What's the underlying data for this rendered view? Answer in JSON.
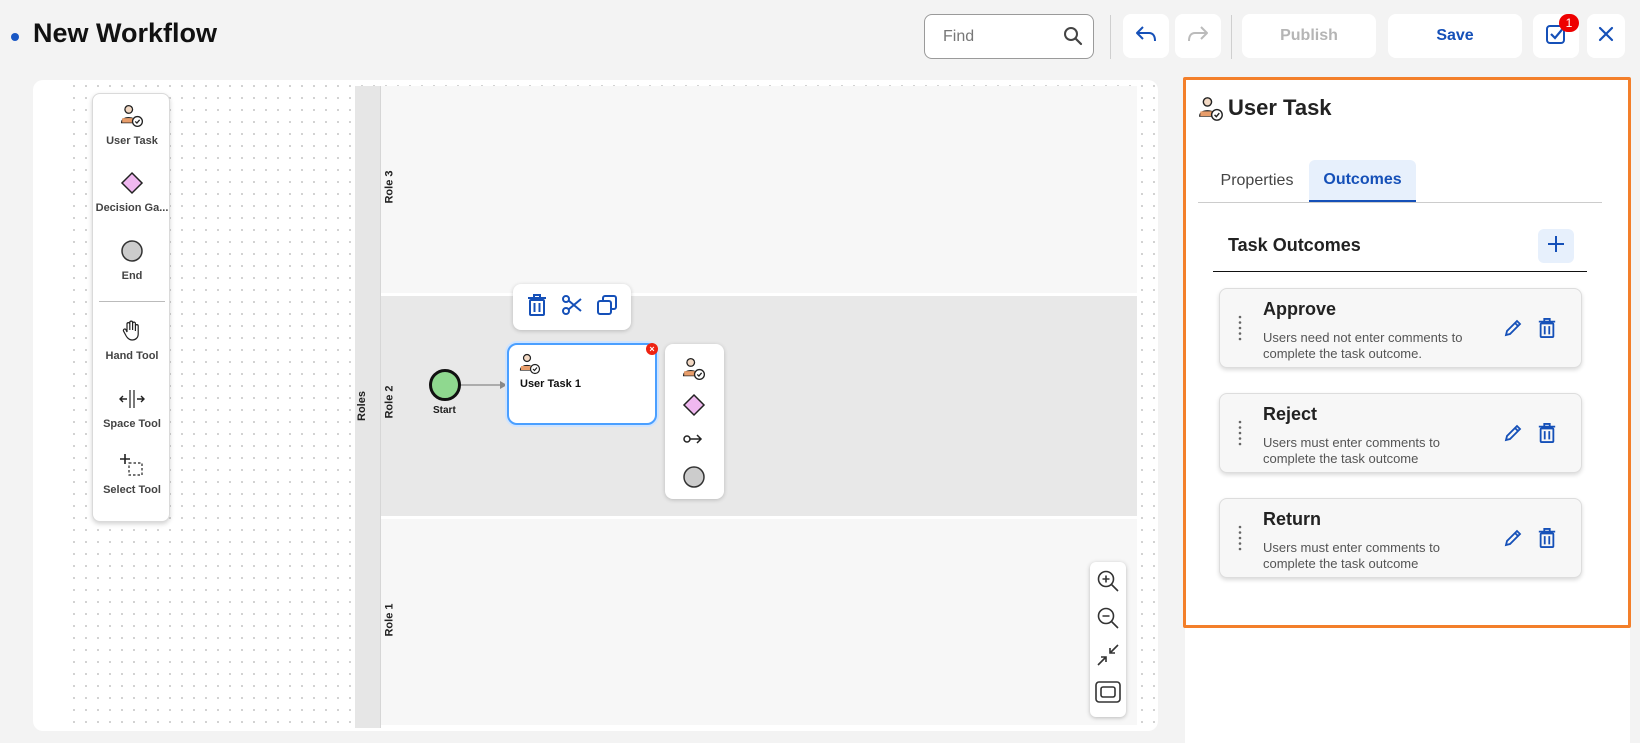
{
  "header": {
    "title": "New Workflow",
    "find_placeholder": "Find",
    "publish_label": "Publish",
    "save_label": "Save",
    "validation_badge": "1"
  },
  "palette": {
    "items": [
      {
        "icon": "user-task-icon",
        "label": "User Task"
      },
      {
        "icon": "decision-gateway-icon",
        "label": "Decision Ga..."
      },
      {
        "icon": "end-event-icon",
        "label": "End"
      },
      {
        "icon": "hand-tool-icon",
        "label": "Hand Tool"
      },
      {
        "icon": "space-tool-icon",
        "label": "Space Tool"
      },
      {
        "icon": "select-tool-icon",
        "label": "Select Tool"
      }
    ]
  },
  "diagram": {
    "pool_label": "Roles",
    "lanes": [
      "Role 3",
      "Role 2",
      "Role 1"
    ],
    "start_label": "Start",
    "task_label": "User Task 1",
    "error_mark": "×"
  },
  "panel": {
    "title": "User Task",
    "tabs": [
      "Properties",
      "Outcomes"
    ],
    "active_tab": "Outcomes",
    "section_title": "Task Outcomes",
    "outcomes": [
      {
        "name": "Approve",
        "description": "Users need not enter comments to complete the task outcome."
      },
      {
        "name": "Reject",
        "description": "Users must enter comments to complete the task outcome"
      },
      {
        "name": "Return",
        "description": "Users must enter comments to complete the task outcome"
      }
    ]
  },
  "colors": {
    "accent": "#1550b8",
    "highlight": "#f37f2a",
    "start_fill": "#8fd88f",
    "gateway_fill": "#f0b8f0",
    "error": "#e21111"
  }
}
